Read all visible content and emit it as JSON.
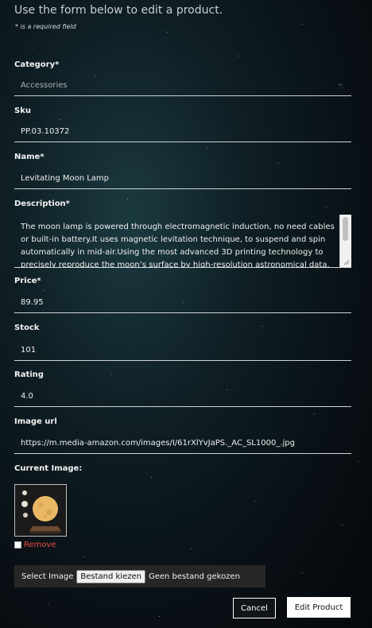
{
  "intro": "Use the form below to edit a product.",
  "required_note": "* is a required field",
  "form": {
    "category": {
      "label": "Category*",
      "value": "Accessories"
    },
    "sku": {
      "label": "Sku",
      "value": "PP.03.10372"
    },
    "name": {
      "label": "Name*",
      "value": "Levitating Moon Lamp"
    },
    "description": {
      "label": "Description*",
      "value": "The moon lamp is powered through electromagnetic induction, no need cables or built-in battery.It uses magnetic levitation technique, to suspend and spin automatically in mid-air.Using the most advanced 3D printing technology to precisely reproduce the moon’s surface by high-resolution astronomical data."
    },
    "price": {
      "label": "Price*",
      "value": "89.95"
    },
    "stock": {
      "label": "Stock",
      "value": "101"
    },
    "rating": {
      "label": "Rating",
      "value": "4.0"
    },
    "image_url": {
      "label": "Image url",
      "value": "https://m.media-amazon.com/images/I/61rXlYvJaPS._AC_SL1000_.jpg"
    },
    "current_image": {
      "label": "Current Image:"
    },
    "remove_label": "Remove",
    "file": {
      "label": "Select Image",
      "button": "Bestand kiezen",
      "status": "Geen bestand gekozen"
    }
  },
  "actions": {
    "cancel": "Cancel",
    "submit": "Edit Product"
  },
  "icons": {
    "select_chevron": "chevron-down-icon",
    "resize": "resize-handle-icon",
    "product_image": "moon-lamp-image"
  },
  "colors": {
    "remove": "#e74c3c",
    "accent_bg": "#0e1f24"
  }
}
